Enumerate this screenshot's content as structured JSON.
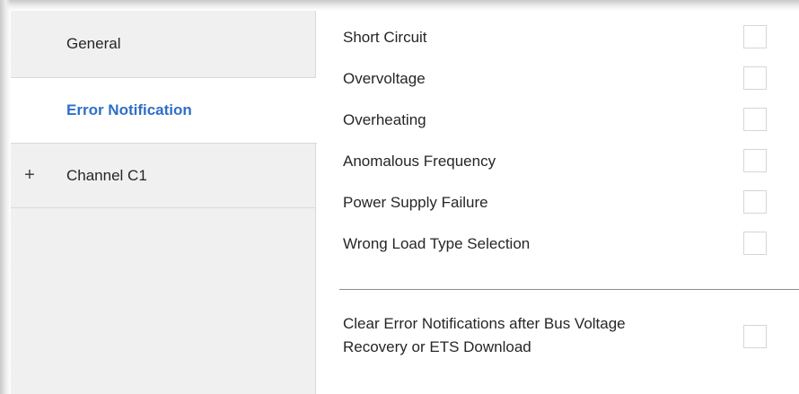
{
  "sidebar": {
    "items": [
      {
        "label": "General",
        "prefix": ""
      },
      {
        "label": "Error Notification",
        "prefix": ""
      },
      {
        "label": "Channel C1",
        "prefix": "+"
      }
    ]
  },
  "main": {
    "options": [
      {
        "label": "Short Circuit",
        "checked": false
      },
      {
        "label": "Overvoltage",
        "checked": false
      },
      {
        "label": "Overheating",
        "checked": false
      },
      {
        "label": "Anomalous Frequency",
        "checked": false
      },
      {
        "label": "Power Supply Failure",
        "checked": false
      },
      {
        "label": "Wrong Load Type Selection",
        "checked": false
      }
    ],
    "clear_option": {
      "line1": "Clear Error Notifications after Bus Voltage",
      "line2": "Recovery or ETS Download",
      "checked": false
    }
  },
  "colors": {
    "selected_item": "#2e6fc7",
    "sidebar_bg": "#f0f0f0",
    "content_bg": "#ffffff"
  }
}
